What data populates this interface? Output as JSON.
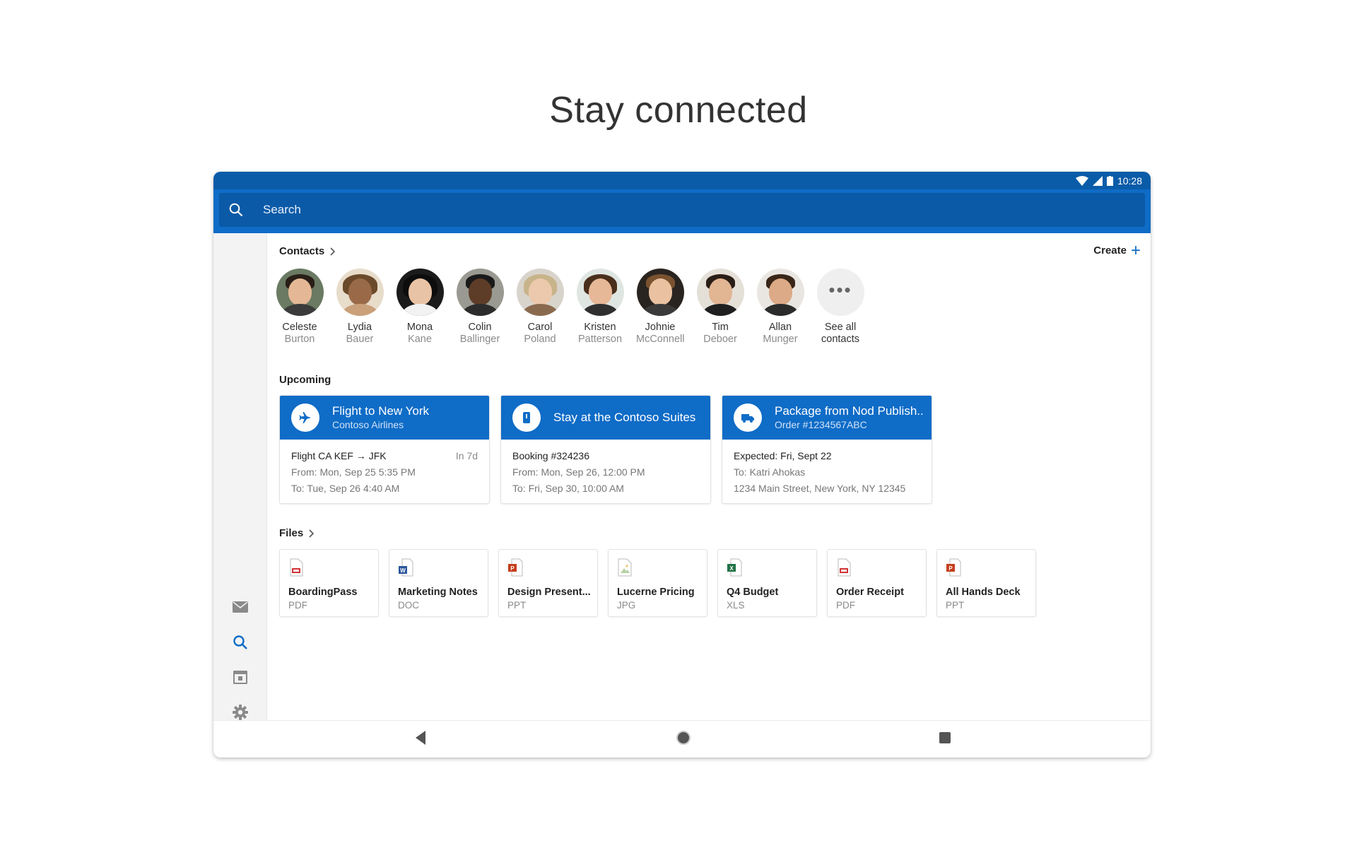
{
  "headline": "Stay connected",
  "status_bar": {
    "time": "10:28"
  },
  "search": {
    "placeholder": "Search"
  },
  "contacts": {
    "title": "Contacts",
    "create_label": "Create",
    "people": [
      {
        "first": "Celeste",
        "last": "Burton"
      },
      {
        "first": "Lydia",
        "last": "Bauer"
      },
      {
        "first": "Mona",
        "last": "Kane"
      },
      {
        "first": "Colin",
        "last": "Ballinger"
      },
      {
        "first": "Carol",
        "last": "Poland"
      },
      {
        "first": "Kristen",
        "last": "Patterson"
      },
      {
        "first": "Johnie",
        "last": "McConnell"
      },
      {
        "first": "Tim",
        "last": "Deboer"
      },
      {
        "first": "Allan",
        "last": "Munger"
      }
    ],
    "see_all": {
      "line1": "See all",
      "line2": "contacts"
    }
  },
  "upcoming": {
    "title": "Upcoming",
    "cards": [
      {
        "icon": "airplane-icon",
        "title": "Flight to New York",
        "subtitle": "Contoso Airlines",
        "line1": "Flight CA KEF → JFK",
        "badge": "In 7d",
        "line2": "From: Mon, Sep 25 5:35 PM",
        "line3": "To: Tue, Sep 26 4:40 AM"
      },
      {
        "icon": "hotel-icon",
        "title": "Stay at the Contoso Suites",
        "subtitle": "",
        "line1": "Booking #324236",
        "badge": "",
        "line2": "From: Mon, Sep 26, 12:00 PM",
        "line3": "To: Fri, Sep 30, 10:00 AM"
      },
      {
        "icon": "truck-icon",
        "title": "Package from Nod Publish..",
        "subtitle": "Order #1234567ABC",
        "line1": "Expected: Fri, Sept 22",
        "badge": "",
        "line2": "To: Katri Ahokas",
        "line3": "1234 Main Street, New York, NY 12345"
      }
    ]
  },
  "files": {
    "title": "Files",
    "items": [
      {
        "name": "BoardingPass",
        "type": "PDF",
        "icon": "pdf-file-icon"
      },
      {
        "name": "Marketing Notes",
        "type": "DOC",
        "icon": "word-file-icon"
      },
      {
        "name": "Design Present...",
        "type": "PPT",
        "icon": "powerpoint-file-icon"
      },
      {
        "name": "Lucerne Pricing",
        "type": "JPG",
        "icon": "image-file-icon"
      },
      {
        "name": "Q4 Budget",
        "type": "XLS",
        "icon": "excel-file-icon"
      },
      {
        "name": "Order Receipt",
        "type": "PDF",
        "icon": "pdf-file-icon"
      },
      {
        "name": "All Hands Deck",
        "type": "PPT",
        "icon": "powerpoint-file-icon"
      }
    ]
  },
  "colors": {
    "brand_blue": "#0f6cc7",
    "status_bar": "#0a5ca8",
    "pdf": "#d13438",
    "word": "#2b579a",
    "powerpoint": "#c43e1c",
    "excel": "#217346"
  }
}
